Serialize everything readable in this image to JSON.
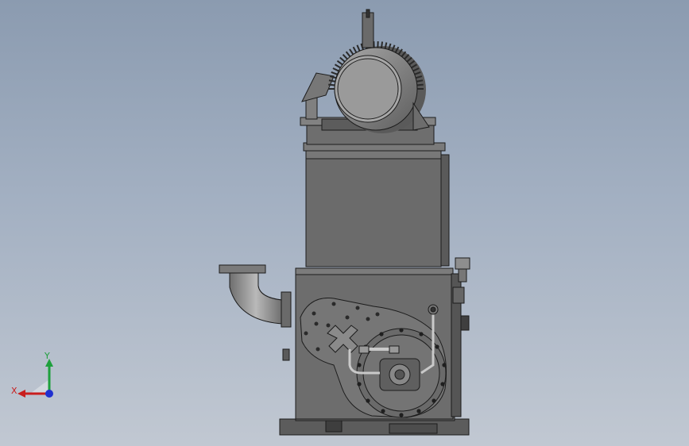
{
  "triad": {
    "x_label": "X",
    "y_label": "Y",
    "x_color": "#c81e1e",
    "y_color": "#1ea03c",
    "z_color": "#2030d0"
  },
  "model": {
    "body_color": "#6b6b6b",
    "shadow_color": "#4a4a4a",
    "light_color": "#8c8c8c",
    "line_color": "#1c1c1c",
    "background_top": "#8b9bb0",
    "background_bottom": "#c1c8d2"
  }
}
